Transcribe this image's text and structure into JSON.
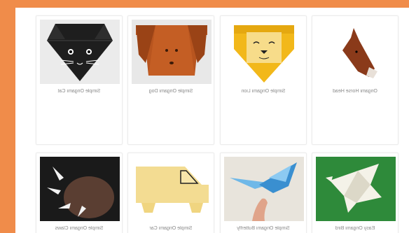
{
  "colors": {
    "frame": "#f08c4a",
    "panel": "#ffffff",
    "caption": "#8a8a8a"
  },
  "cards": [
    {
      "title": "Simple Origami Cat",
      "icon": "origami-cat-image"
    },
    {
      "title": "Simple Origami Dog",
      "icon": "origami-dog-image"
    },
    {
      "title": "Simple Origami Lion",
      "icon": "origami-lion-image"
    },
    {
      "title": "Origami Horse Head",
      "icon": "origami-horse-head-image"
    },
    {
      "title": "Simple Origami Claws",
      "icon": "origami-claws-image"
    },
    {
      "title": "Simple Origami Car",
      "icon": "origami-car-image"
    },
    {
      "title": "Simple Origami Butterfly",
      "icon": "origami-butterfly-image"
    },
    {
      "title": "Easy Origami Bird",
      "icon": "origami-bird-image"
    }
  ]
}
